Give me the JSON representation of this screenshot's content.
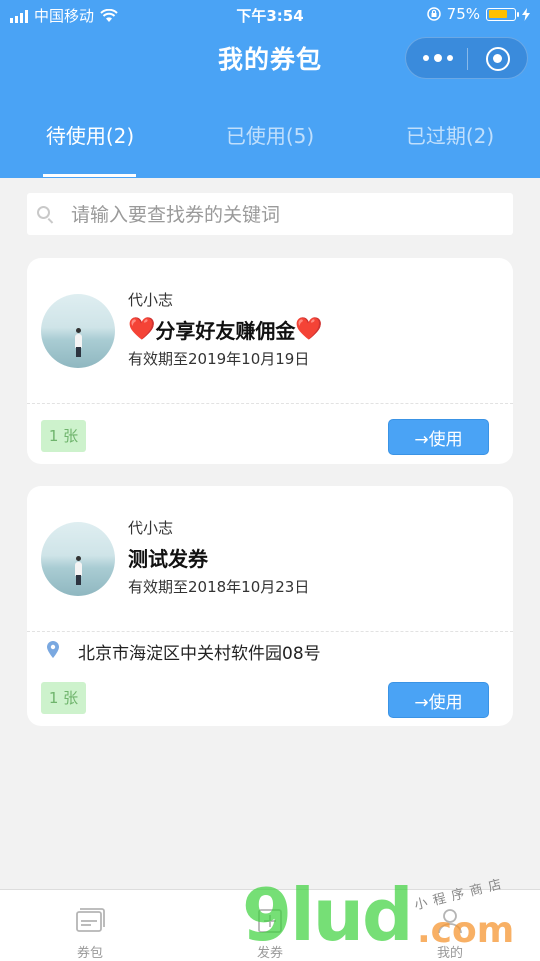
{
  "status_bar": {
    "carrier": "中国移动",
    "time": "下午3:54",
    "battery_percent": "75%",
    "battery_level": 0.75,
    "icons": [
      "signal-icon",
      "wifi-icon",
      "lock-rotation-icon",
      "battery-icon",
      "charging-icon"
    ]
  },
  "header": {
    "title": "我的券包",
    "capsule_icons": [
      "more-icon",
      "close-miniprogram-icon"
    ]
  },
  "tabs": [
    {
      "label": "待使用(2)",
      "active": true
    },
    {
      "label": "已使用(5)",
      "active": false
    },
    {
      "label": "已过期(2)",
      "active": false
    }
  ],
  "search": {
    "placeholder": "请输入要查找券的关键词",
    "value": ""
  },
  "coupons": [
    {
      "issuer": "代小志",
      "title": "分享好友赚佣金",
      "title_prefix_icon": "❤️",
      "title_suffix_icon": "❤️",
      "expiry": "有效期至2019年10月19日",
      "quantity": "1 张",
      "use_label": "→使用"
    },
    {
      "issuer": "代小志",
      "title": "测试发券",
      "expiry": "有效期至2018年10月23日",
      "location": "北京市海淀区中关村软件园08号",
      "quantity": "1 张",
      "use_label": "→使用"
    }
  ],
  "tabbar": [
    {
      "label": "券包",
      "icon": "coupon-wallet-icon"
    },
    {
      "label": "发券",
      "icon": "issue-coupon-icon"
    },
    {
      "label": "我的",
      "icon": "profile-icon"
    }
  ],
  "watermark": {
    "brand": "9lud",
    "suffix": ".com",
    "tagline": "小程序商店"
  },
  "colors": {
    "primary": "#4aa3f5",
    "background": "#f2f2f2",
    "quantity_bg": "#cdf2cc",
    "quantity_text": "#6fb46c",
    "heart": "#e8202a"
  }
}
